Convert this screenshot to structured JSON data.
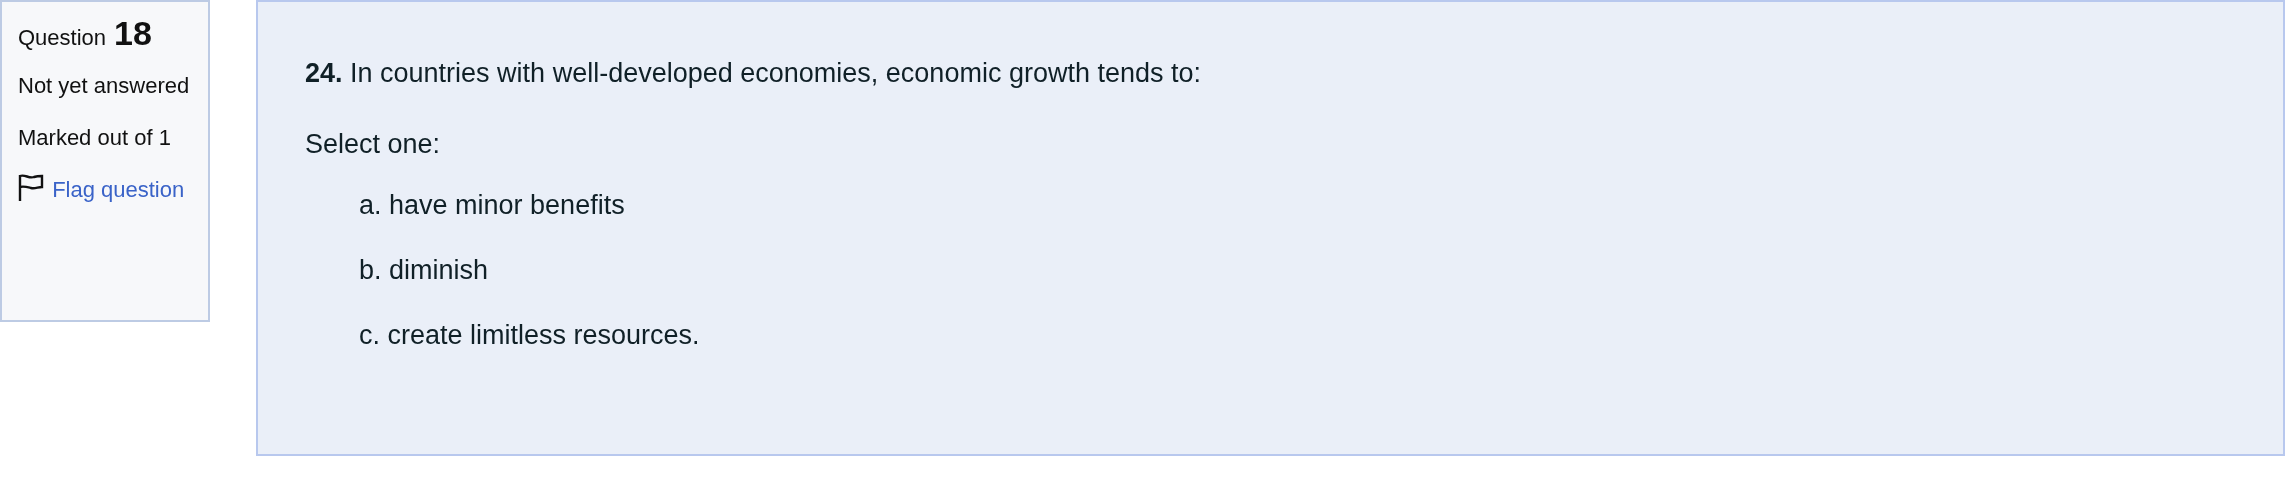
{
  "info": {
    "question_label": "Question",
    "number": "18",
    "state": "Not yet answered",
    "grade": "Marked out of 1",
    "flag_link": "Flag question"
  },
  "content": {
    "question": "**24.** In countries with well-developed economies, economic growth tends to:",
    "prompt": "Select one:",
    "options": [
      {
        "label": "a. have minor benefits"
      },
      {
        "label": "b. diminish"
      },
      {
        "label": "c. create limitless resources."
      }
    ]
  }
}
